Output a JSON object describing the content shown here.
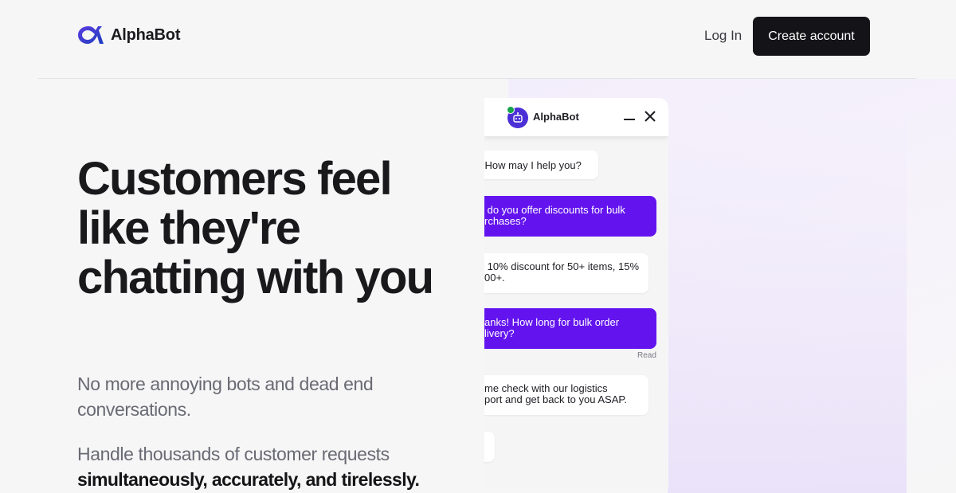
{
  "header": {
    "brand": "AlphaBot",
    "login_label": "Log In",
    "create_account_label": "Create account",
    "brand_color": "#3d35c8"
  },
  "hero": {
    "title_lines": [
      "Customers feel",
      "like they're",
      "chatting with you"
    ],
    "lead": "No more annoying bots and dead end conversations.",
    "lead2_prefix": "Handle thousands of customer requests",
    "lead2_bold": "simultaneously, accurately, and tirelessly."
  },
  "chat": {
    "bot_name": "AlphaBot",
    "online_color": "#15a34a",
    "user_bubble_color": "#6314ee",
    "messages": [
      {
        "from": "bot",
        "line1": "o. How may I help you?",
        "line2": ""
      },
      {
        "from": "user",
        "line1": " do you offer discounts for bulk",
        "line2": "rchases?"
      },
      {
        "from": "bot",
        "line1": " 10% discount for 50+ items, 15%",
        "line2": "00+."
      },
      {
        "from": "user",
        "line1": "anks! How long for bulk order",
        "line2": "livery?"
      },
      {
        "from": "bot",
        "line1": "me check with our logistics",
        "line2": "port and get back to you ASAP."
      }
    ],
    "read_receipt": "Read"
  }
}
